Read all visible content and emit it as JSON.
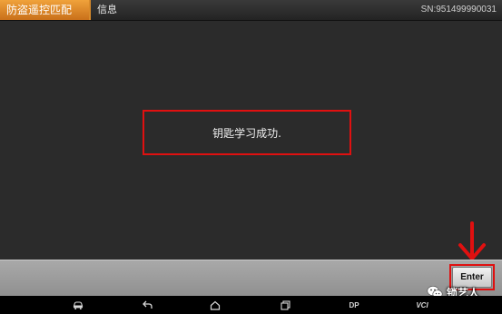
{
  "header": {
    "app_title": "防盗遥控匹配",
    "info_label": "信息",
    "serial": "SN:951499990031"
  },
  "dialog": {
    "message": "钥匙学习成功."
  },
  "actions": {
    "enter_label": "Enter"
  },
  "navbar": {
    "items": [
      {
        "icon": "vehicle-icon"
      },
      {
        "icon": "back-icon"
      },
      {
        "icon": "home-icon"
      },
      {
        "icon": "recent-apps-icon"
      },
      {
        "label": "DP"
      },
      {
        "label": "VCI"
      }
    ]
  },
  "watermark": {
    "text": "锁艺人",
    "icon": "wechat-icon"
  },
  "colors": {
    "accent_orange": "#e0882a",
    "highlight_red": "#e01010",
    "background": "#2b2b2b",
    "action_bar": "#9e9e9e"
  }
}
